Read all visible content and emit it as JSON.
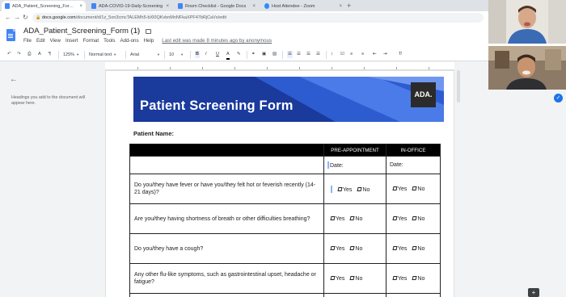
{
  "browser": {
    "tabs": [
      {
        "label": "ADA_Patient_Screening_Form (1)",
        "favicon_color": "#4285f4"
      },
      {
        "label": "ADA-COVID-19-Daily-Screening",
        "favicon_color": "#4285f4"
      },
      {
        "label": "Room Checklist - Google Docs",
        "favicon_color": "#4285f4"
      },
      {
        "label": "Host Attendee - Zoom",
        "favicon_color": "#2d8cff"
      }
    ],
    "url_host": "docs.google.com",
    "url_path": "/document/d/1z_5on3cmcTALEMh5-bXl0QKvbnMnNFkaXPF47bRjCaVs/edit"
  },
  "doc": {
    "title": "ADA_Patient_Screening_Form (1)",
    "menus": [
      "File",
      "Edit",
      "View",
      "Insert",
      "Format",
      "Tools",
      "Add-ons",
      "Help"
    ],
    "last_edit": "Last edit was made 8 minutes ago by anonymous"
  },
  "toolbar": {
    "zoom": "125%",
    "style": "Normal text",
    "font": "Arial",
    "font_size": "10",
    "bold": "B",
    "italic": "I",
    "underline": "U",
    "text_color": "A"
  },
  "outline": {
    "hint": "Headings you add to the document will appear here."
  },
  "form": {
    "banner_title": "Patient Screening Form",
    "logo": "ADA.",
    "patient_name_label": "Patient Name:",
    "col_pre": "PRE-APPOINTMENT",
    "col_office": "IN-OFFICE",
    "date_label": "Date:",
    "yes": "Yes",
    "no": "No",
    "questions": [
      "Do you/they have fever or have you/they felt hot or feverish recently (14-21 days)?",
      "Are you/they having shortness of breath or other difficulties breathing?",
      "Do you/they have a cough?",
      "Any other flu-like symptoms, such as gastrointestinal upset, headache or fatigue?"
    ]
  },
  "colors": {
    "banner_blue": "#1a3a9c",
    "docs_blue": "#4285f4",
    "accent_check": "#1a73e8"
  }
}
